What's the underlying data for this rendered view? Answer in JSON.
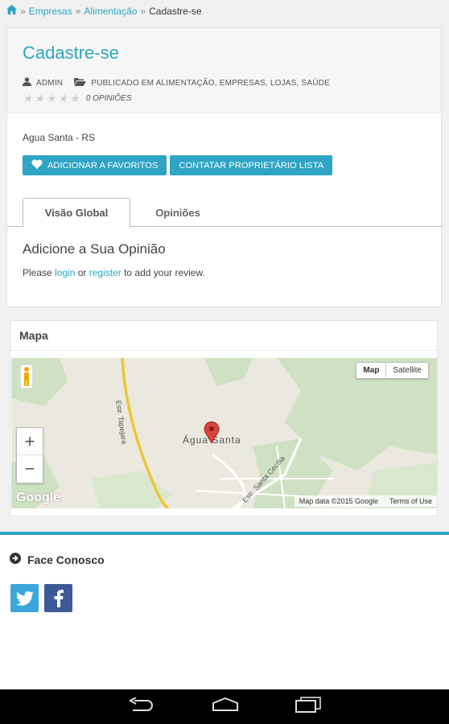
{
  "breadcrumb": {
    "home_icon": "home-icon",
    "sep1": "»",
    "link1": "Empresas",
    "sep2": "»",
    "link2": "Alimentação",
    "sep3": "»",
    "current": "Cadastre-se"
  },
  "listing": {
    "title": "Cadastre-se",
    "author": "ADMIN",
    "published": "PUBLICADO EM ALIMENTAÇÃO, EMPRESAS, LOJAS, SAÚDE",
    "rating_count": "0 OPINIÕES",
    "stars": 0,
    "location": "Agua Santa - RS",
    "favorites_button": "ADICIONAR A FAVORITOS",
    "contact_button": "CONTATAR PROPRIETÁRIO LISTA"
  },
  "tabs": [
    {
      "label": "Visão Global",
      "active": true
    },
    {
      "label": "Opiniões",
      "active": false
    }
  ],
  "review": {
    "heading": "Adicione a Sua Opinião",
    "text_pre": "Please ",
    "login": "login",
    "text_mid": " or ",
    "register": "register",
    "text_post": " to add your review."
  },
  "map": {
    "heading": "Mapa",
    "type_map": "Map",
    "type_satellite": "Satellite",
    "zoom_in": "+",
    "zoom_out": "−",
    "place_label": "Água Santa",
    "road1": "Estr. Tapejara",
    "road2": "Estr. Santa Cecília",
    "logo": "Google",
    "attribution": "Map data ©2015 Google",
    "terms": "Terms of Use"
  },
  "footer": {
    "title": "Face Conosco"
  },
  "colors": {
    "accent": "#2fa4c4",
    "facebook": "#3b5a96",
    "twitter": "#3aa6db"
  }
}
